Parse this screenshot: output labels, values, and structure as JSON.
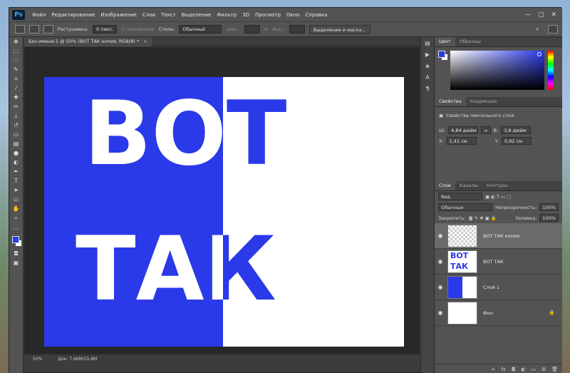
{
  "app": {
    "logo": "Ps"
  },
  "menu": [
    "Файл",
    "Редактирование",
    "Изображение",
    "Слои",
    "Текст",
    "Выделение",
    "Фильтр",
    "3D",
    "Просмотр",
    "Окно",
    "Справка"
  ],
  "window_controls": [
    "—",
    "▢",
    "✕"
  ],
  "options": {
    "feather_label": "Растушевка:",
    "feather_value": "0 пикс.",
    "antialias_label": "Сглаживание",
    "style_label": "Стиль:",
    "style_value": "Обычный",
    "width_label": "Шир.:",
    "height_label": "Выс.:",
    "select_mask_button": "Выделение и маска..."
  },
  "document": {
    "tab_title": "Без имени-1 @ 50% (ВОТ ТАК копия, RGB/8) *",
    "zoom": "50%",
    "doc_info": "Док: 7,66M/15,8M",
    "art_line1": "ВОТ",
    "art_line2": "ТАК"
  },
  "colors": {
    "accent_blue": "#2a3ae8",
    "white": "#ffffff"
  },
  "panels": {
    "color_tabs": [
      "Цвет",
      "Образцы"
    ],
    "properties_tabs": [
      "Свойства",
      "Коррекция"
    ],
    "properties_title": "Свойства пиксельного слоя",
    "w_label": "Ш:",
    "w_value": "4,84 дюйм",
    "h_label": "В:",
    "h_value": "3,8 дюйм",
    "x_label": "X:",
    "x_value": "1,41 см",
    "y_label": "Y:",
    "y_value": "0,92 см",
    "layers_tabs": [
      "Слои",
      "Каналы",
      "Контуры"
    ],
    "kind_filter": "Вид",
    "blend_mode": "Обычные",
    "opacity_label": "Непрозрачность:",
    "opacity_value": "100%",
    "lock_label": "Закрепить:",
    "fill_label": "Заливка:",
    "fill_value": "100%",
    "layers": [
      {
        "name": "ВОТ ТАК копия",
        "active": true
      },
      {
        "name": "ВОТ ТАК",
        "active": false
      },
      {
        "name": "Слой 1",
        "active": false
      },
      {
        "name": "Фон",
        "active": false,
        "locked": true
      }
    ]
  }
}
